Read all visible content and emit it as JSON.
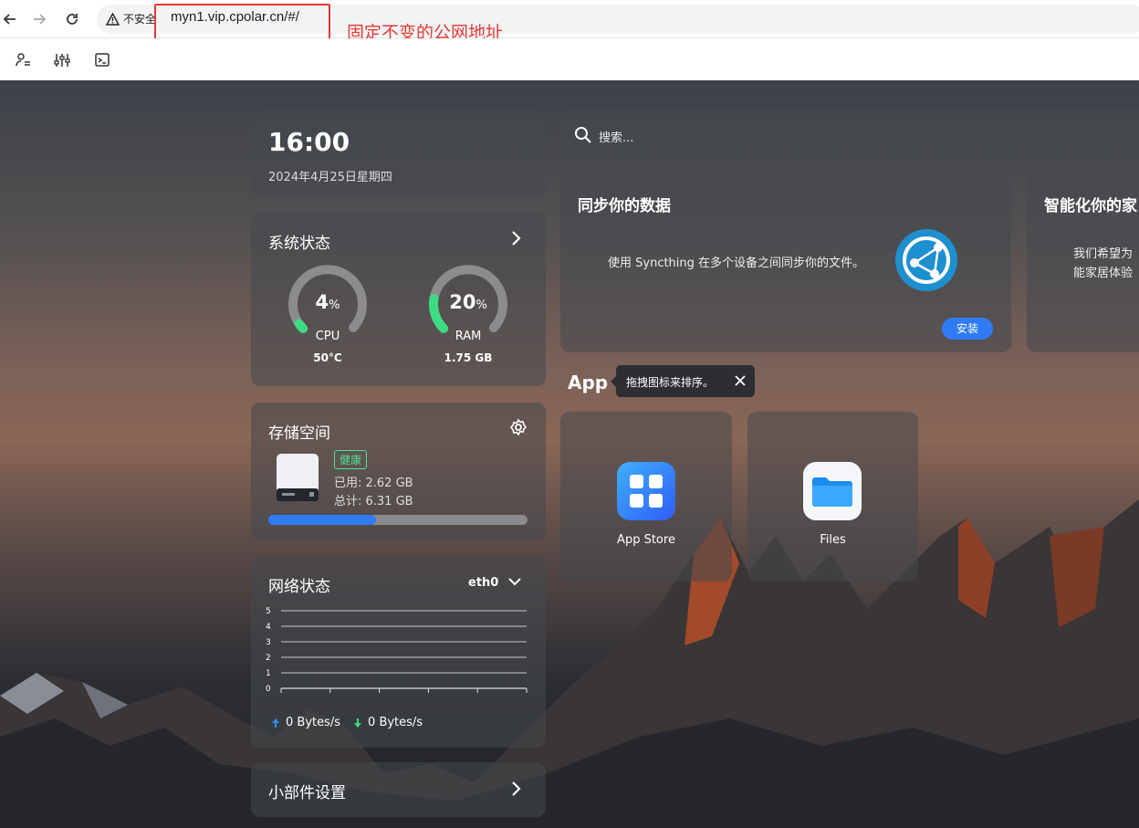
{
  "browser": {
    "security_label": "不安全",
    "url": "myn1.vip.cpolar.cn/#/",
    "annotation": "固定不变的公网地址"
  },
  "clock": {
    "time": "16:00",
    "date": "2024年4月25日星期四"
  },
  "system": {
    "title": "系统状态",
    "cpu": {
      "value": "4",
      "unit": "%",
      "label": "CPU",
      "sub": "50°C",
      "percent": 4
    },
    "ram": {
      "value": "20",
      "unit": "%",
      "label": "RAM",
      "sub": "1.75 GB",
      "percent": 20
    }
  },
  "storage": {
    "title": "存储空间",
    "badge": "健康",
    "used": "已用: 2.62 GB",
    "total": "总计: 6.31 GB",
    "percent": 41.5
  },
  "network": {
    "title": "网络状态",
    "interface": "eth0",
    "y_ticks": [
      "5",
      "4",
      "3",
      "2",
      "1",
      "0"
    ],
    "up": "0 Bytes/s",
    "down": "0 Bytes/s"
  },
  "widgets": {
    "title": "小部件设置"
  },
  "search": {
    "placeholder": "搜索..."
  },
  "sync_card": {
    "title": "同步你的数据",
    "text": "使用 Syncthing 在多个设备之间同步你的文件。",
    "button": "安装"
  },
  "smart_card": {
    "title": "智能化你的家",
    "text_line1": "我们希望为",
    "text_line2": "能家居体验"
  },
  "apps": {
    "title": "App",
    "tooltip": "拖拽图标来排序。",
    "items": [
      {
        "label": "App Store"
      },
      {
        "label": "Files"
      }
    ]
  },
  "colors": {
    "accent": "#2f7bf6",
    "green": "#3ddc84",
    "annotation_red": "#e53935"
  }
}
